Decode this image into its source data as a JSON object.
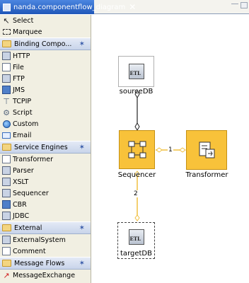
{
  "editor": {
    "tab_title": "nanda.componentflow_diagram",
    "tab_close": "✕"
  },
  "palette": {
    "tools": [
      {
        "label": "Select",
        "icon": "select-arrow-icon"
      },
      {
        "label": "Marquee",
        "icon": "marquee-icon"
      }
    ],
    "drawers": [
      {
        "label": "Binding Compo...",
        "items": [
          {
            "label": "HTTP",
            "icon": "http-icon"
          },
          {
            "label": "File",
            "icon": "file-icon"
          },
          {
            "label": "FTP",
            "icon": "ftp-icon"
          },
          {
            "label": "JMS",
            "icon": "jms-icon"
          },
          {
            "label": "TCPIP",
            "icon": "tcpip-icon"
          },
          {
            "label": "Script",
            "icon": "script-icon"
          },
          {
            "label": "Custom",
            "icon": "custom-icon"
          },
          {
            "label": "Email",
            "icon": "email-icon"
          }
        ]
      },
      {
        "label": "Service Engines",
        "items": [
          {
            "label": "Transformer",
            "icon": "transformer-icon"
          },
          {
            "label": "Parser",
            "icon": "parser-icon"
          },
          {
            "label": "XSLT",
            "icon": "xslt-icon"
          },
          {
            "label": "Sequencer",
            "icon": "sequencer-icon"
          },
          {
            "label": "CBR",
            "icon": "cbr-icon"
          },
          {
            "label": "JDBC",
            "icon": "jdbc-icon"
          }
        ]
      },
      {
        "label": "External",
        "items": [
          {
            "label": "ExternalSystem",
            "icon": "external-system-icon"
          },
          {
            "label": "Comment",
            "icon": "comment-icon"
          }
        ]
      },
      {
        "label": "Message Flows",
        "items": [
          {
            "label": "MessageExchange",
            "icon": "message-exchange-icon"
          }
        ]
      }
    ]
  },
  "diagram": {
    "nodes": {
      "source": {
        "label": "sourceDB"
      },
      "sequencer": {
        "label": "Sequencer"
      },
      "transformer": {
        "label": "Transformer"
      },
      "target": {
        "label": "targetDB"
      }
    },
    "links": {
      "seq_to_transformer": "1",
      "seq_to_target": "2"
    },
    "colors": {
      "component_fill": "#f8c23a",
      "link_line": "#f0c040"
    }
  }
}
